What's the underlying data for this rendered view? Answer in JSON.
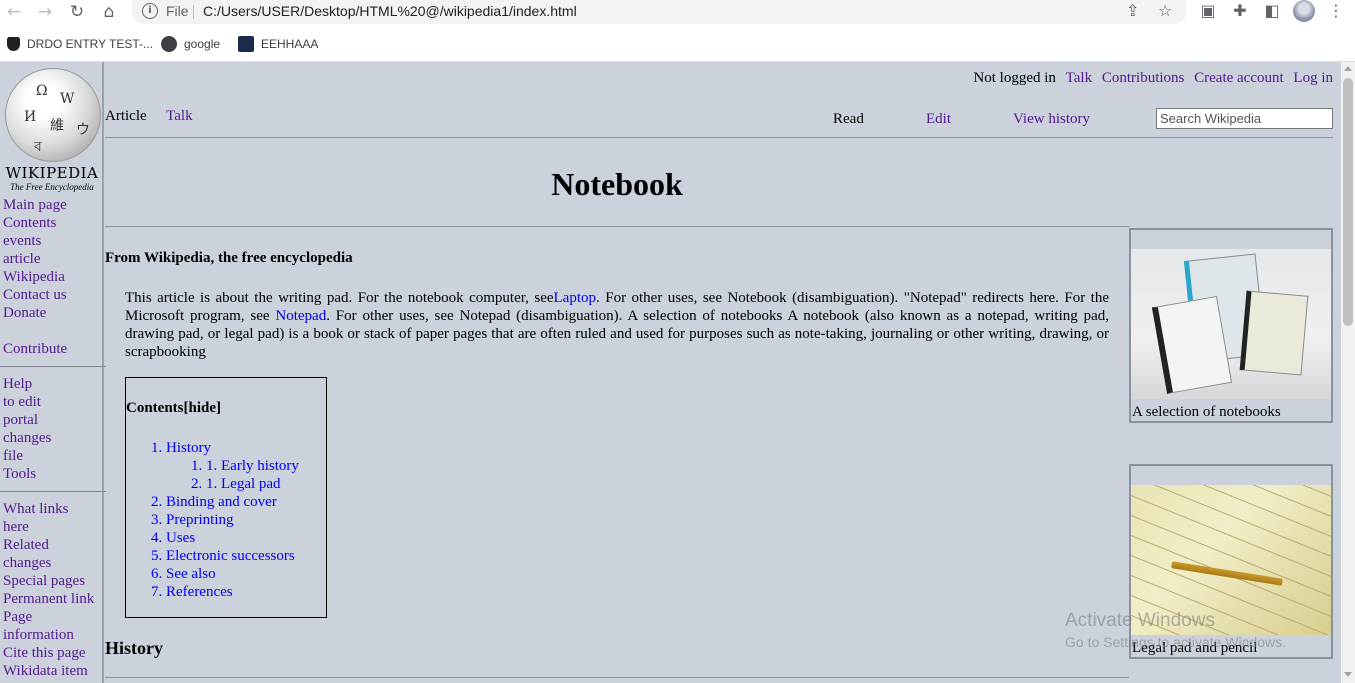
{
  "browser": {
    "file_label": "File",
    "url": "C:/Users/USER/Desktop/HTML%20@/wikipedia1/index.html",
    "bookmarks": [
      "DRDO ENTRY TEST-...",
      "google",
      "EEHHAAA"
    ]
  },
  "logo": {
    "wordmark": "WIKIPEDIA",
    "tagline": "The Free Encyclopedia"
  },
  "sidebar": {
    "group1": [
      "Main page",
      "Contents",
      "events",
      "article",
      "Wikipedia",
      "Contact us",
      "Donate"
    ],
    "contribute": "Contribute",
    "group2": [
      "Help",
      "to edit",
      "portal",
      "changes",
      "file",
      "Tools"
    ],
    "group3": [
      "What links",
      "here",
      "Related",
      "changes",
      "Special pages",
      "Permanent link",
      "Page",
      "information",
      "Cite this page",
      "Wikidata item"
    ]
  },
  "personal": {
    "not_logged_in": "Not logged in",
    "talk": "Talk",
    "contributions": "Contributions",
    "create_account": "Create account",
    "log_in": "Log in"
  },
  "tabs": {
    "article": "Article",
    "talk": "Talk",
    "read": "Read",
    "edit": "Edit",
    "view_history": "View history"
  },
  "search": {
    "placeholder": "Search Wikipedia"
  },
  "article": {
    "title": "Notebook",
    "from": "From Wikipedia, the free encyclopedia",
    "intro_1": "This article is about the writing pad. For the notebook computer, see",
    "intro_link1": "Laptop",
    "intro_2": ". For other uses, see Notebook (disambiguation). \"Notepad\" redirects here. For the Microsoft program, see ",
    "intro_link2": "Notepad",
    "intro_3": ". For other uses, see Notepad (disambiguation). A selection of notebooks A notebook (also known as a notepad, writing pad, drawing pad, or legal pad) is a book or stack of paper pages that are often ruled and used for purposes such as note-taking, journaling or other writing, drawing, or scrapbooking",
    "history_heading": "History"
  },
  "toc": {
    "heading": "Contents[hide]",
    "items": [
      "1. History",
      "1. 1. Early history",
      "2. 1. Legal pad",
      "2. Binding and cover",
      "3. Preprinting",
      "4. Uses",
      "5. Electronic successors",
      "6. See also",
      "7. References"
    ]
  },
  "figures": {
    "fig1_caption": "A selection of notebooks",
    "fig2_caption": "Legal pad and pencil"
  },
  "watermark": {
    "line1": "Activate Windows",
    "line2": "Go to Settings to activate Windows."
  },
  "colors": {
    "page_bg": "#cbd2dc",
    "link": "#0000ee",
    "visited": "#551a8b"
  }
}
